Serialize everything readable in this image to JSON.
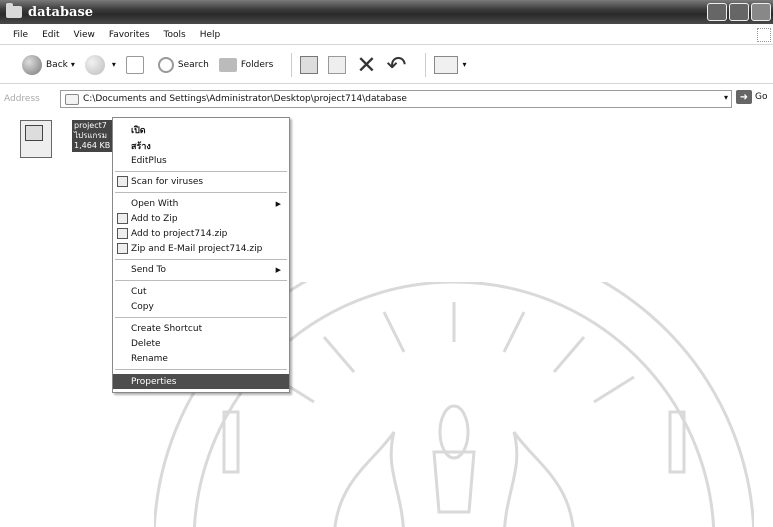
{
  "window": {
    "title": "database"
  },
  "menubar": {
    "items": [
      "File",
      "Edit",
      "View",
      "Favorites",
      "Tools",
      "Help"
    ]
  },
  "toolbar": {
    "back_label": "Back",
    "search_label": "Search",
    "folders_label": "Folders"
  },
  "address": {
    "label": "Address",
    "path": "C:\\Documents and Settings\\Administrator\\Desktop\\project714\\database",
    "go_label": "Go"
  },
  "file": {
    "name": "project7",
    "type": "ไปรแกรม",
    "size": "1,464 KB"
  },
  "context_menu": {
    "open": "เปิด",
    "create": "สร้าง",
    "editplus": "EditPlus",
    "scan": "Scan for viruses",
    "open_with": "Open With",
    "add_zip": "Add to Zip",
    "add_project_zip": "Add to project714.zip",
    "zip_email": "Zip and E-Mail project714.zip",
    "send_to": "Send To",
    "cut": "Cut",
    "copy": "Copy",
    "create_shortcut": "Create Shortcut",
    "delete": "Delete",
    "rename": "Rename",
    "properties": "Properties"
  },
  "icons": {
    "folder": "folder-icon",
    "scan": "shield-icon",
    "zip": "zip-icon",
    "submenu": "chevron-right-icon"
  }
}
